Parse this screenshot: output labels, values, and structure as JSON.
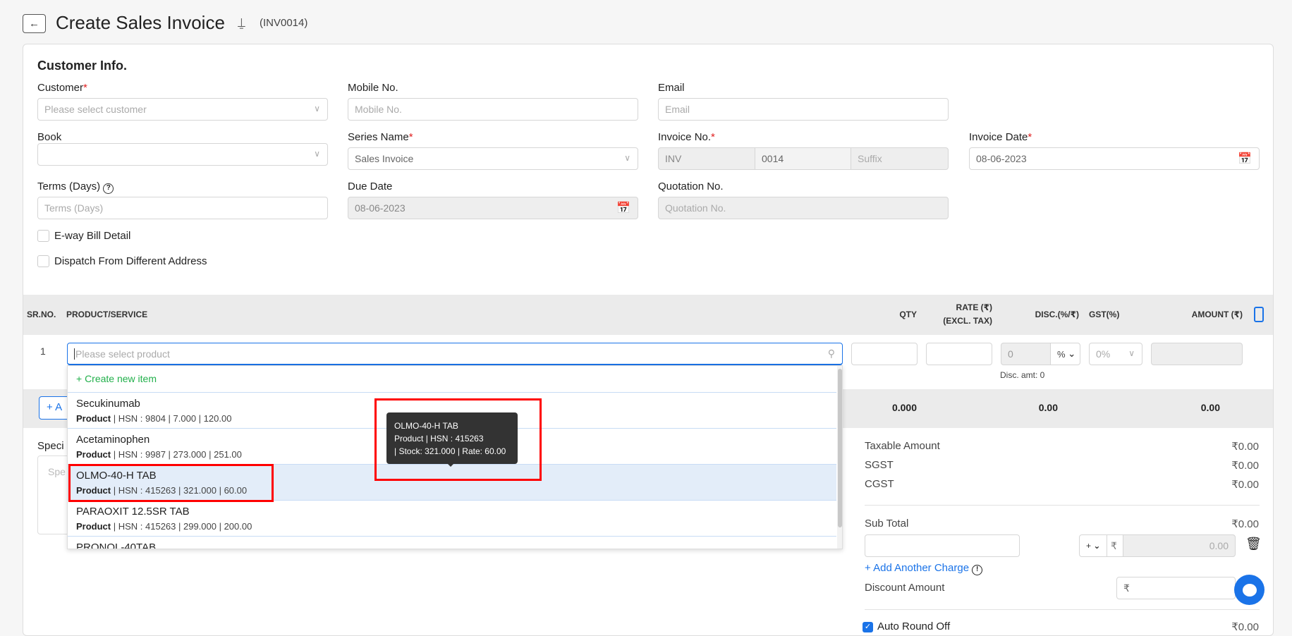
{
  "header": {
    "title": "Create Sales Invoice",
    "invoice_code": "(INV0014)",
    "back_icon": "arrow-left-icon",
    "pin_icon": "pin-icon"
  },
  "customer_info": {
    "heading": "Customer Info.",
    "customer": {
      "label": "Customer",
      "placeholder": "Please select customer"
    },
    "mobile": {
      "label": "Mobile No.",
      "placeholder": "Mobile No."
    },
    "email": {
      "label": "Email",
      "placeholder": "Email"
    },
    "book": {
      "label": "Book",
      "value": ""
    },
    "series": {
      "label": "Series Name",
      "value": "Sales Invoice"
    },
    "invoice_no": {
      "label": "Invoice No.",
      "prefix": "INV",
      "number": "0014",
      "suffix_placeholder": "Suffix"
    },
    "invoice_date": {
      "label": "Invoice Date",
      "value": "08-06-2023"
    },
    "terms": {
      "label": "Terms (Days)",
      "placeholder": "Terms (Days)"
    },
    "due_date": {
      "label": "Due Date",
      "value": "08-06-2023"
    },
    "quotation": {
      "label": "Quotation No.",
      "placeholder": "Quotation No."
    },
    "eway_label": "E-way Bill Detail",
    "dispatch_label": "Dispatch From Different Address"
  },
  "table": {
    "headers": {
      "sr": "SR.NO.",
      "product": "PRODUCT/SERVICE",
      "qty": "QTY",
      "rate1": "RATE (₹)",
      "rate2": "(EXCL. TAX)",
      "disc": "DISC.(%/₹)",
      "gst": "GST(%)",
      "amount": "AMOUNT (₹)"
    },
    "row": {
      "sr": "1",
      "product_placeholder": "Please select product",
      "disc_value": "0",
      "disc_type": "%",
      "gst": "0%",
      "disc_amt": "Disc. amt: 0"
    },
    "totals": {
      "qty": "0.000",
      "disc": "0.00",
      "amount": "0.00"
    },
    "add_label": "+ A"
  },
  "dropdown": {
    "create": "+ Create new item",
    "items": [
      {
        "name": "Secukinumab",
        "type": "Product",
        "rest": " | HSN : 9804 | 7.000 | 120.00"
      },
      {
        "name": "Acetaminophen",
        "type": "Product",
        "rest": " | HSN : 9987 | 273.000 | 251.00"
      },
      {
        "name": "OLMO-40-H TAB",
        "type": "Product",
        "rest": " | HSN : 415263 | 321.000 | 60.00"
      },
      {
        "name": "PARAOXIT 12.5SR TAB",
        "type": "Product",
        "rest": " | HSN : 415263 | 299.000 | 200.00"
      },
      {
        "name": "PRONOL-40TAB",
        "type": "",
        "rest": ""
      }
    ]
  },
  "tooltip": {
    "line1": "OLMO-40-H TAB",
    "line2": "Product | HSN : 415263",
    "line3": "| Stock: 321.000 | Rate: 60.00"
  },
  "notes": {
    "label": "Speci",
    "placeholder": "Spe"
  },
  "summary": {
    "taxable": {
      "label": "Taxable Amount",
      "value": "₹0.00"
    },
    "sgst": {
      "label": "SGST",
      "value": "₹0.00"
    },
    "cgst": {
      "label": "CGST",
      "value": "₹0.00"
    },
    "subtotal": {
      "label": "Sub Total",
      "value": "₹0.00"
    },
    "charge": {
      "sign": "+",
      "currency": "₹",
      "value": "0.00"
    },
    "add_charge": "+ Add Another Charge",
    "discount": {
      "label": "Discount Amount",
      "currency": "₹"
    },
    "round_off": {
      "label": "Auto Round Off",
      "value": "₹0.00",
      "checked": true
    }
  },
  "colors": {
    "accent": "#1a73e8",
    "create_green": "#22b04b",
    "highlight": "#e3edf9",
    "required": "#e02020"
  }
}
